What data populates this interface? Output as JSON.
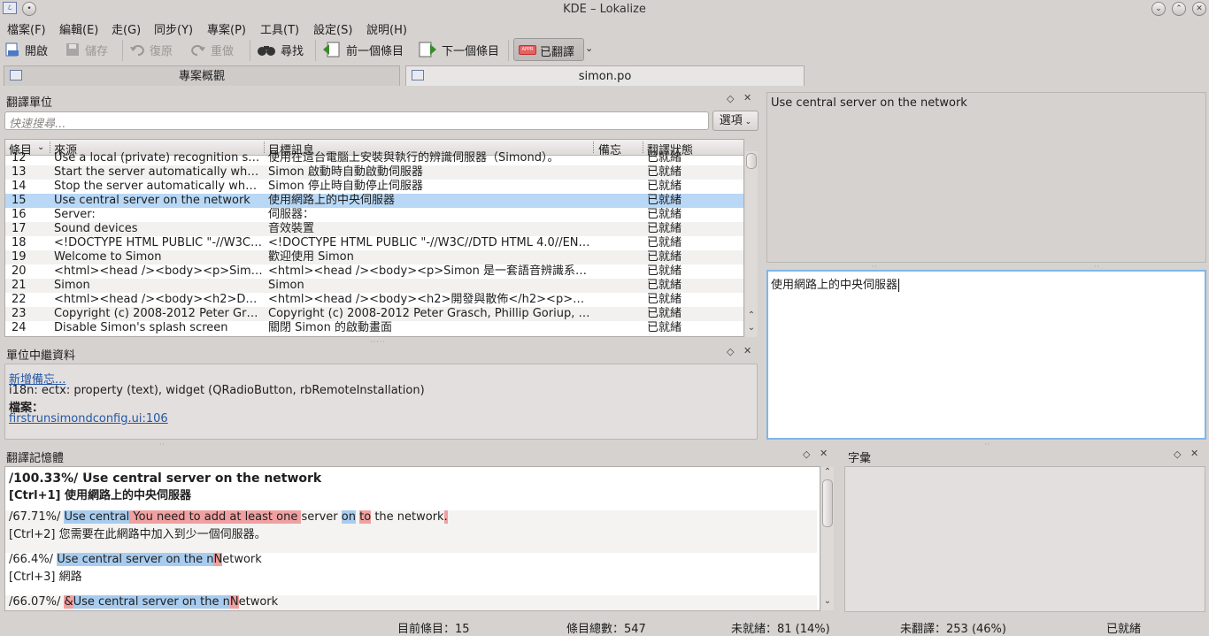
{
  "window": {
    "title": "KDE – Lokalize"
  },
  "menubar": [
    "檔案(F)",
    "編輯(E)",
    "走(G)",
    "同步(Y)",
    "專案(P)",
    "工具(T)",
    "設定(S)",
    "說明(H)"
  ],
  "toolbar": {
    "open": "開啟",
    "save": "儲存",
    "undo": "復原",
    "redo": "重做",
    "find": "尋找",
    "prev": "前一個條目",
    "next": "下一個條目",
    "translated": "已翻譯"
  },
  "tabs": [
    "專案概觀",
    "simon.po"
  ],
  "units_panel": {
    "title": "翻譯單位",
    "search_placeholder": "快速搜尋...",
    "options": "選項",
    "columns": [
      "條目",
      "來源",
      "目標訊息",
      "備忘",
      "翻譯狀態"
    ],
    "rows": [
      {
        "n": "12",
        "src": "Use a local (private) recognition se…",
        "tgt": "使用在這台電腦上安裝與執行的辨識伺服器（Simond）。",
        "status": "已就緒"
      },
      {
        "n": "13",
        "src": "Start the server automatically whe…",
        "tgt": "Simon 啟動時自動啟動伺服器",
        "status": "已就緒"
      },
      {
        "n": "14",
        "src": "Stop the server automatically whe…",
        "tgt": "Simon 停止時自動停止伺服器",
        "status": "已就緒"
      },
      {
        "n": "15",
        "src": "Use central server on the network",
        "tgt": "使用網路上的中央伺服器",
        "status": "已就緒"
      },
      {
        "n": "16",
        "src": "Server:",
        "tgt": "伺服器：",
        "status": "已就緒"
      },
      {
        "n": "17",
        "src": "Sound devices",
        "tgt": "音效裝置",
        "status": "已就緒"
      },
      {
        "n": "18",
        "src": "<!DOCTYPE HTML PUBLIC \"-//W3C/…",
        "tgt": "<!DOCTYPE HTML PUBLIC \"-//W3C//DTD HTML 4.0//EN\"…",
        "status": "已就緒"
      },
      {
        "n": "19",
        "src": "Welcome to Simon",
        "tgt": "歡迎使用 Simon",
        "status": "已就緒"
      },
      {
        "n": "20",
        "src": "<html><head /><body><p>Simon i…",
        "tgt": "<html><head /><body><p>Simon 是一套語音辨識系統…",
        "status": "已就緒"
      },
      {
        "n": "21",
        "src": "Simon",
        "tgt": "Simon",
        "status": "已就緒"
      },
      {
        "n": "22",
        "src": "<html><head /><body><h2>Devel…",
        "tgt": "<html><head /><body><h2>開發與散佈</h2><p>部份…",
        "status": "已就緒"
      },
      {
        "n": "23",
        "src": "Copyright (c) 2008-2012 Peter Gra…",
        "tgt": "Copyright (c) 2008-2012 Peter Grasch, Phillip Goriup, T…",
        "status": "已就緒"
      },
      {
        "n": "24",
        "src": "Disable Simon's splash screen",
        "tgt": "關閉 Simon 的啟動畫面",
        "status": "已就緒"
      }
    ]
  },
  "metadata_panel": {
    "title": "單位中繼資料",
    "add_note": "新增備忘...",
    "context": "i18n: ectx: property (text), widget (QRadioButton, rbRemoteInstallation)",
    "file_label": "檔案：",
    "file_link": "firstrunsimondconfig.ui:106"
  },
  "source_text": "Use central server on the network",
  "target_text": "使用網路上的中央伺服器",
  "tm_panel": {
    "title": "翻譯記憶體",
    "e1_score": "/100.33%/ Use central server on the network",
    "e1_tr": "[Ctrl+1] 使用網路上的中央伺服器",
    "e2_score": "/67.71%/ ",
    "e2_a": "Use central",
    "e2_b": " You need to add at least one ",
    "e2_c": "server ",
    "e2_d": "on",
    "e2_e": " ",
    "e2_f": "to",
    "e2_g": " the network",
    "e2_h": ".",
    "e2_tr": "[Ctrl+2] 您需要在此網路中加入到少一個伺服器。",
    "e3_score": "/66.4%/ ",
    "e3_a": "Use central server on the n",
    "e3_b": "N",
    "e3_c": "etwork",
    "e3_tr": "[Ctrl+3] 網路",
    "e4_score": "/66.07%/ ",
    "e4_a": "&",
    "e4_b": "Use central server on the n",
    "e4_c": "N",
    "e4_d": "etwork"
  },
  "glossary_panel": {
    "title": "字彙"
  },
  "statusbar": {
    "current": "目前條目：15",
    "total": "條目總數：547",
    "fuzzy": "未就緒：81 (14%)",
    "untranslated": "未翻譯：253 (46%)",
    "state": "已就緒"
  },
  "colors": {
    "selection": "#b8d8f6",
    "match_blue": "#a8ccef",
    "match_red": "#f0a0a0",
    "link": "#2457a6",
    "focus": "#7fb6e8"
  }
}
